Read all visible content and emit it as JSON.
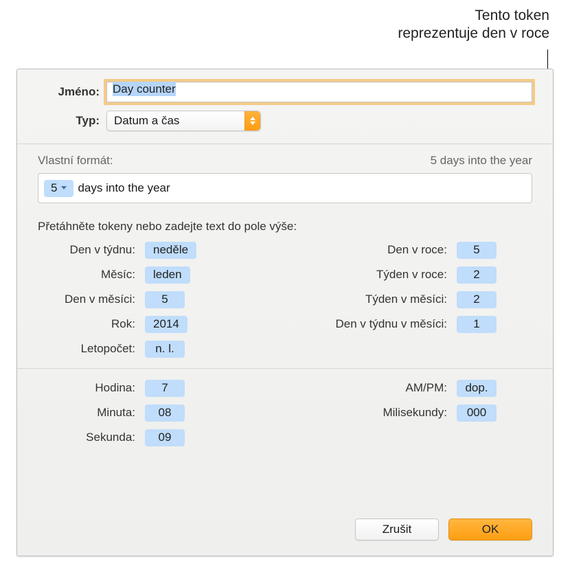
{
  "callout": {
    "line1": "Tento token",
    "line2": "reprezentuje den v roce"
  },
  "labels": {
    "name": "Jméno:",
    "type": "Typ:",
    "custom_format": "Vlastní formát:",
    "instructions": "Přetáhněte tokeny nebo zadejte text do pole výše:"
  },
  "name_field": {
    "value": "Day counter"
  },
  "type_select": {
    "value": "Datum a čas"
  },
  "custom_format": {
    "preview": "5 days into the year",
    "token_value": "5",
    "trailing_text": "days into the year"
  },
  "tokens": {
    "left": [
      {
        "label": "Den v týdnu:",
        "value": "neděle"
      },
      {
        "label": "Měsíc:",
        "value": "leden"
      },
      {
        "label": "Den v měsíci:",
        "value": "5"
      },
      {
        "label": "Rok:",
        "value": "2014"
      },
      {
        "label": "Letopočet:",
        "value": "n. l."
      }
    ],
    "right": [
      {
        "label": "Den v roce:",
        "value": "5"
      },
      {
        "label": "Týden v roce:",
        "value": "2"
      },
      {
        "label": "Týden v měsíci:",
        "value": "2"
      },
      {
        "label": "Den v týdnu v měsíci:",
        "value": "1"
      }
    ],
    "time_left": [
      {
        "label": "Hodina:",
        "value": "7"
      },
      {
        "label": "Minuta:",
        "value": "08"
      },
      {
        "label": "Sekunda:",
        "value": "09"
      }
    ],
    "time_right": [
      {
        "label": "AM/PM:",
        "value": "dop."
      },
      {
        "label": "Milisekundy:",
        "value": "000"
      }
    ]
  },
  "buttons": {
    "cancel": "Zrušit",
    "ok": "OK"
  }
}
